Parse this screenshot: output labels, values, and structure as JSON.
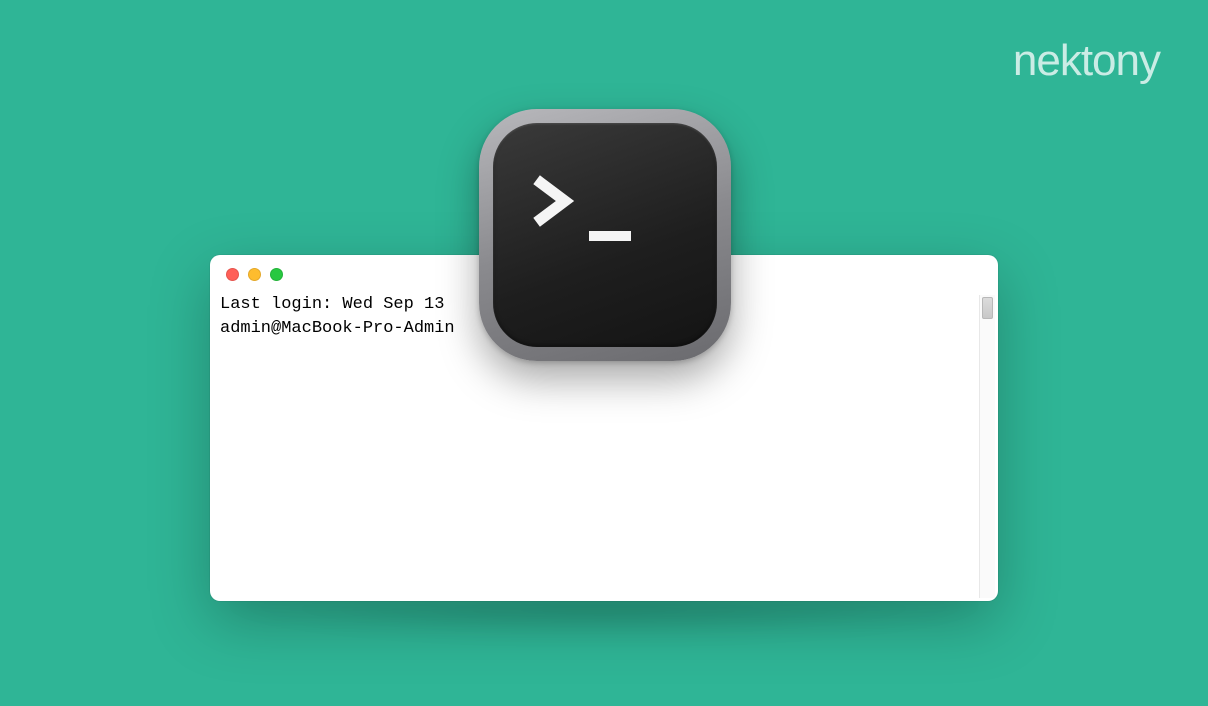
{
  "brand": {
    "logo_text": "nektony"
  },
  "terminal": {
    "line1": "Last login: Wed Sep 13",
    "line2": "admin@MacBook-Pro-Admin"
  },
  "app_icon": {
    "name": "terminal-app-icon",
    "prompt_symbol": ">",
    "cursor_symbol": "_"
  }
}
